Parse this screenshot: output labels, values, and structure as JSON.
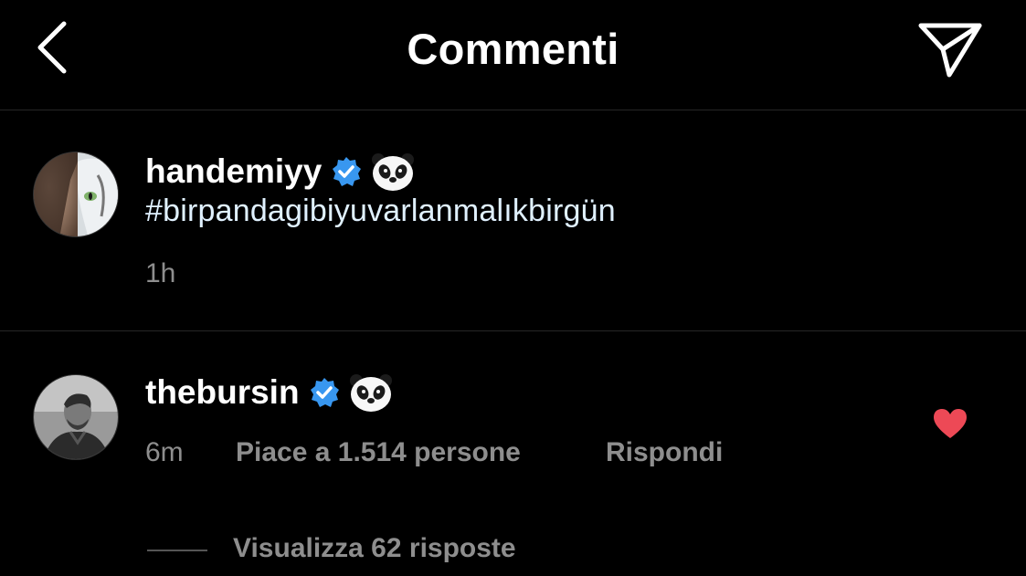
{
  "header": {
    "title": "Commenti",
    "back_icon": "chevron-left-icon",
    "send_icon": "paper-plane-icon"
  },
  "caption": {
    "username": "handemiyy",
    "verified": true,
    "emoji": "panda-emoji",
    "text": "#birpandagibiyuvarlanmalıkbirgün",
    "time": "1h"
  },
  "comment": {
    "username": "thebursin",
    "verified": true,
    "emoji": "panda-emoji",
    "time": "6m",
    "likes_label": "Piace a 1.514 persone",
    "reply_label": "Rispondi",
    "liked": true,
    "view_replies_label": "Visualizza 62 risposte"
  },
  "colors": {
    "background": "#000000",
    "verified_badge": "#3897f0",
    "like_heart": "#ed4956",
    "secondary_text": "#8e8e8e",
    "divider": "#262626"
  }
}
